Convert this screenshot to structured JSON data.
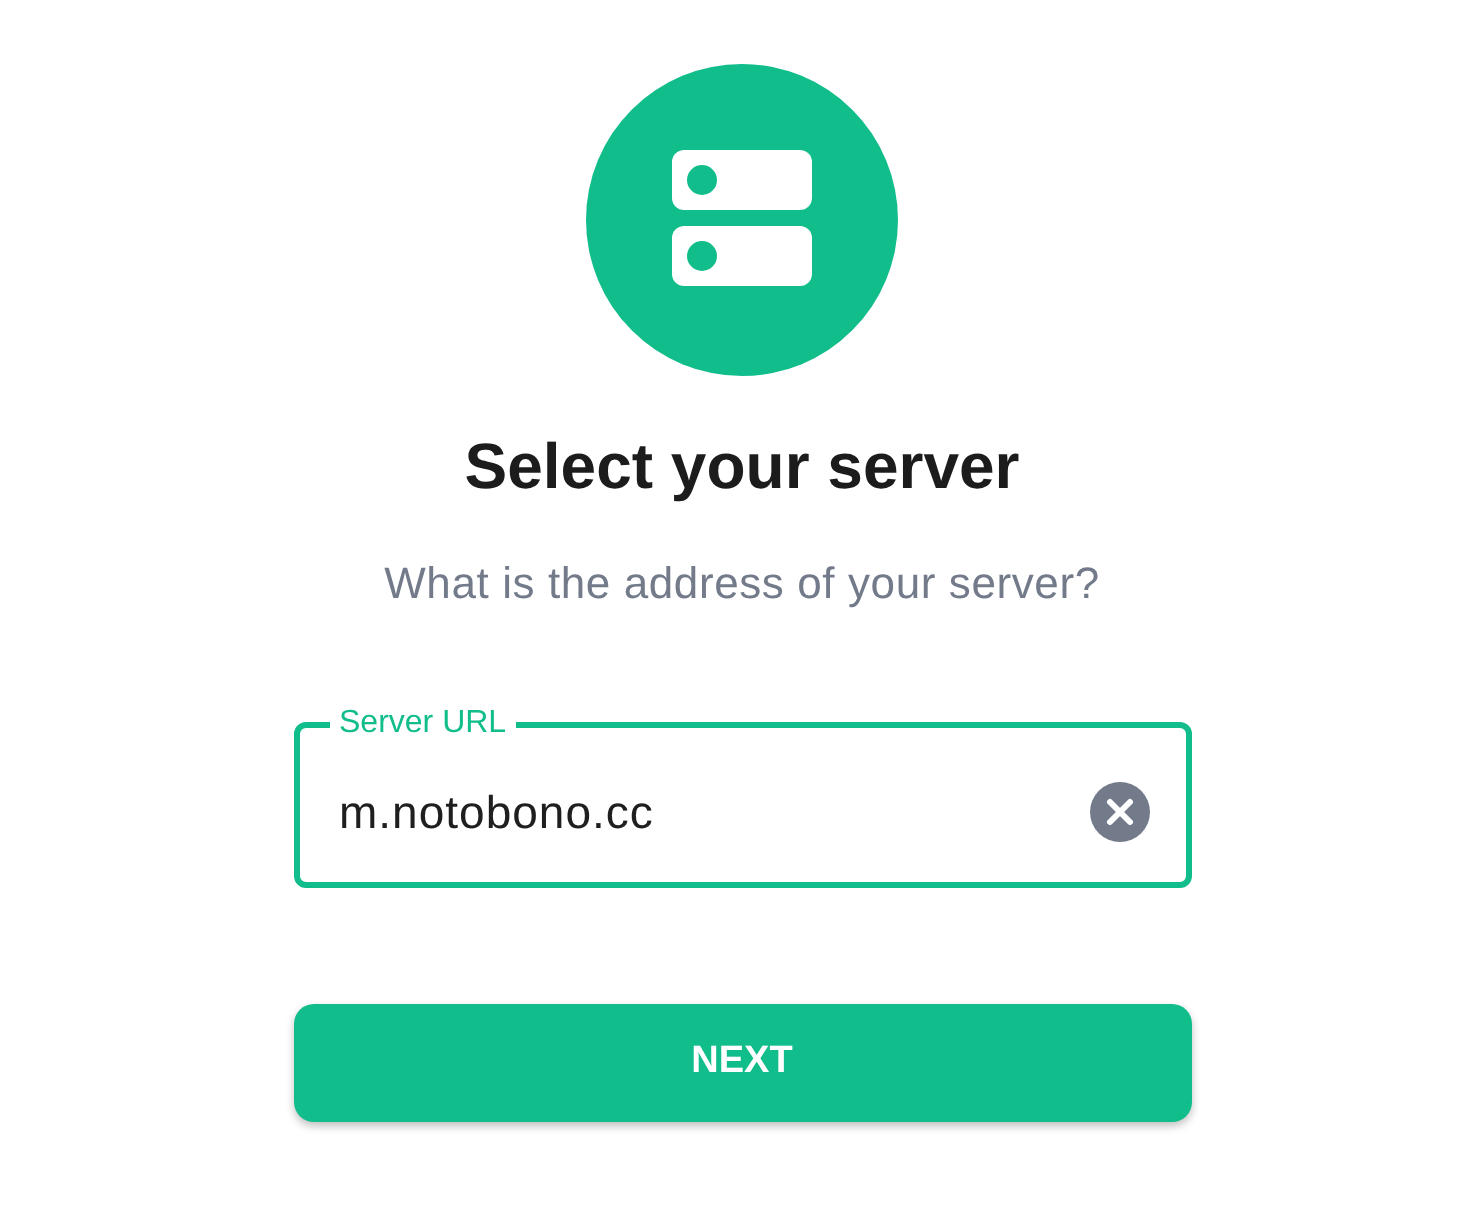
{
  "header": {
    "title": "Select your server",
    "subtitle": "What is the address of your server?"
  },
  "server_field": {
    "label": "Server URL",
    "value": "m.notobono.cc",
    "focused": true
  },
  "next_button": {
    "label": "NEXT"
  }
}
